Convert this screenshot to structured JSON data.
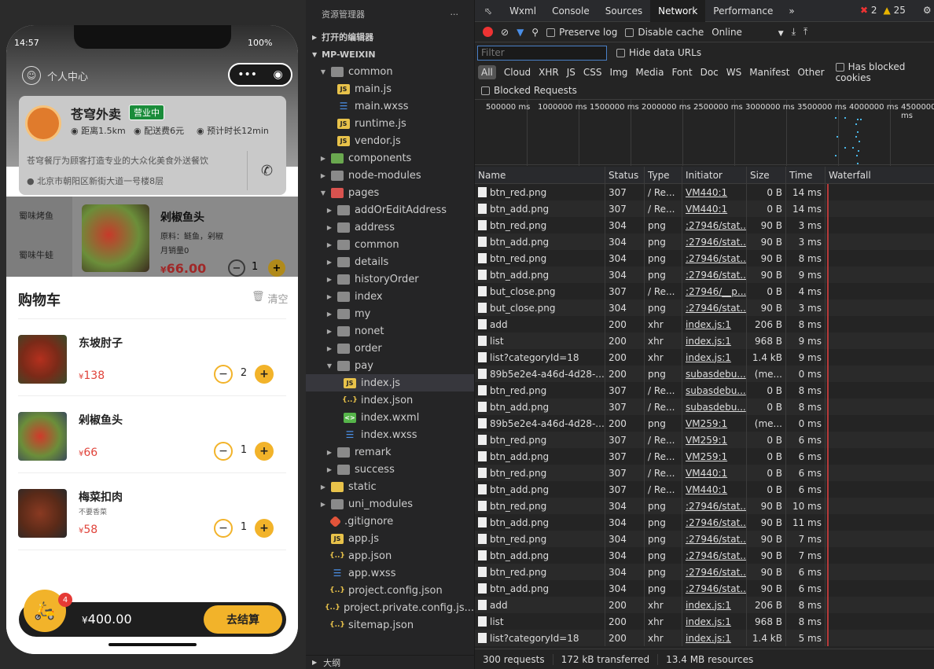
{
  "phone": {
    "time": "14:57",
    "battery": "100%",
    "user_center": "个人中心",
    "shop": {
      "name": "苍穹外卖",
      "badge": "营业中",
      "distance": "距离1.5km",
      "delivery_fee": "配送费6元",
      "eta": "预计时长12min",
      "desc": "苍穹餐厅为顾客打造专业的大众化美食外送餐饮",
      "address": "北京市朝阳区新街大道一号楼8层"
    },
    "categories": [
      "蜀味烤鱼",
      "蜀味牛蛙"
    ],
    "dish": {
      "name": "剁椒鱼头",
      "material": "原料：鲢鱼，剁椒",
      "sales": "月销量0",
      "price": "66.00",
      "qty": "1"
    },
    "cart": {
      "title": "购物车",
      "clear": "清空",
      "items": [
        {
          "name": "东坡肘子",
          "note": "",
          "price": "138",
          "qty": "2"
        },
        {
          "name": "剁椒鱼头",
          "note": "",
          "price": "66",
          "qty": "1"
        },
        {
          "name": "梅菜扣肉",
          "note": "不要香菜",
          "price": "58",
          "qty": "1"
        }
      ],
      "badge": "4",
      "total": "400.00",
      "checkout": "去结算"
    }
  },
  "explorer": {
    "title": "资源管理器",
    "open_editors": "打开的编辑器",
    "project": "MP-WEIXIN",
    "tree": [
      {
        "name": "common",
        "type": "folder",
        "indent": 1,
        "open": true
      },
      {
        "name": "main.js",
        "type": "js",
        "indent": 2
      },
      {
        "name": "main.wxss",
        "type": "wxss",
        "indent": 2
      },
      {
        "name": "runtime.js",
        "type": "js",
        "indent": 2
      },
      {
        "name": "vendor.js",
        "type": "js",
        "indent": 2
      },
      {
        "name": "components",
        "type": "comp",
        "indent": 1
      },
      {
        "name": "node-modules",
        "type": "folder",
        "indent": 1
      },
      {
        "name": "pages",
        "type": "pages",
        "indent": 1,
        "open": true
      },
      {
        "name": "addOrEditAddress",
        "type": "folder",
        "indent": 2
      },
      {
        "name": "address",
        "type": "folder",
        "indent": 2
      },
      {
        "name": "common",
        "type": "folder",
        "indent": 2
      },
      {
        "name": "details",
        "type": "folder",
        "indent": 2
      },
      {
        "name": "historyOrder",
        "type": "folder",
        "indent": 2
      },
      {
        "name": "index",
        "type": "folder",
        "indent": 2
      },
      {
        "name": "my",
        "type": "folder",
        "indent": 2
      },
      {
        "name": "nonet",
        "type": "folder",
        "indent": 2
      },
      {
        "name": "order",
        "type": "folder",
        "indent": 2
      },
      {
        "name": "pay",
        "type": "folder",
        "indent": 2,
        "open": true
      },
      {
        "name": "index.js",
        "type": "js",
        "indent": 3,
        "selected": true
      },
      {
        "name": "index.json",
        "type": "json",
        "indent": 3
      },
      {
        "name": "index.wxml",
        "type": "wxml",
        "indent": 3
      },
      {
        "name": "index.wxss",
        "type": "wxss",
        "indent": 3
      },
      {
        "name": "remark",
        "type": "folder",
        "indent": 2
      },
      {
        "name": "success",
        "type": "folder",
        "indent": 2
      },
      {
        "name": "static",
        "type": "static",
        "indent": 1
      },
      {
        "name": "uni_modules",
        "type": "folder",
        "indent": 1
      },
      {
        "name": ".gitignore",
        "type": "git",
        "indent": 1
      },
      {
        "name": "app.js",
        "type": "js",
        "indent": 1
      },
      {
        "name": "app.json",
        "type": "json",
        "indent": 1
      },
      {
        "name": "app.wxss",
        "type": "wxss",
        "indent": 1
      },
      {
        "name": "project.config.json",
        "type": "json",
        "indent": 1
      },
      {
        "name": "project.private.config.js...",
        "type": "json",
        "indent": 1
      },
      {
        "name": "sitemap.json",
        "type": "json",
        "indent": 1
      }
    ],
    "outline": "大纲"
  },
  "devtools": {
    "tabs": [
      "Wxml",
      "Console",
      "Sources",
      "Network",
      "Performance"
    ],
    "active_tab": "Network",
    "errors": "2",
    "warnings": "25",
    "preserve_log": "Preserve log",
    "disable_cache": "Disable cache",
    "throttle": "Online",
    "filter_placeholder": "Filter",
    "hide_data_urls": "Hide data URLs",
    "types": [
      "All",
      "Cloud",
      "XHR",
      "JS",
      "CSS",
      "Img",
      "Media",
      "Font",
      "Doc",
      "WS",
      "Manifest",
      "Other"
    ],
    "has_blocked_cookies": "Has blocked cookies",
    "blocked_requests": "Blocked Requests",
    "ticks": [
      "500000 ms",
      "1000000 ms",
      "1500000 ms",
      "2000000 ms",
      "2500000 ms",
      "3000000 ms",
      "3500000 ms",
      "4000000 ms",
      "4500000 ms"
    ],
    "columns": [
      "Name",
      "Status",
      "Type",
      "Initiator",
      "Size",
      "Time",
      "Waterfall"
    ],
    "requests": [
      [
        "btn_red.png",
        "307",
        "/ Re...",
        "VM440:1",
        "0 B",
        "14 ms"
      ],
      [
        "btn_add.png",
        "307",
        "/ Re...",
        "VM440:1",
        "0 B",
        "14 ms"
      ],
      [
        "btn_red.png",
        "304",
        "png",
        ":27946/stat...",
        "90 B",
        "3 ms"
      ],
      [
        "btn_add.png",
        "304",
        "png",
        ":27946/stat...",
        "90 B",
        "3 ms"
      ],
      [
        "btn_red.png",
        "304",
        "png",
        ":27946/stat...",
        "90 B",
        "8 ms"
      ],
      [
        "btn_add.png",
        "304",
        "png",
        ":27946/stat...",
        "90 B",
        "9 ms"
      ],
      [
        "but_close.png",
        "307",
        "/ Re...",
        ":27946/__p...",
        "0 B",
        "4 ms"
      ],
      [
        "but_close.png",
        "304",
        "png",
        ":27946/stat...",
        "90 B",
        "3 ms"
      ],
      [
        "add",
        "200",
        "xhr",
        "index.js:1",
        "206 B",
        "8 ms"
      ],
      [
        "list",
        "200",
        "xhr",
        "index.js:1",
        "968 B",
        "9 ms"
      ],
      [
        "list?categoryId=18",
        "200",
        "xhr",
        "index.js:1",
        "1.4 kB",
        "9 ms"
      ],
      [
        "89b5e2e4-a46d-4d28-...",
        "200",
        "png",
        "subasdebu...",
        "(me...",
        "0 ms"
      ],
      [
        "btn_red.png",
        "307",
        "/ Re...",
        "subasdebu...",
        "0 B",
        "8 ms"
      ],
      [
        "btn_add.png",
        "307",
        "/ Re...",
        "subasdebu...",
        "0 B",
        "8 ms"
      ],
      [
        "89b5e2e4-a46d-4d28-...",
        "200",
        "png",
        "VM259:1",
        "(me...",
        "0 ms"
      ],
      [
        "btn_red.png",
        "307",
        "/ Re...",
        "VM259:1",
        "0 B",
        "6 ms"
      ],
      [
        "btn_add.png",
        "307",
        "/ Re...",
        "VM259:1",
        "0 B",
        "6 ms"
      ],
      [
        "btn_red.png",
        "307",
        "/ Re...",
        "VM440:1",
        "0 B",
        "6 ms"
      ],
      [
        "btn_add.png",
        "307",
        "/ Re...",
        "VM440:1",
        "0 B",
        "6 ms"
      ],
      [
        "btn_red.png",
        "304",
        "png",
        ":27946/stat...",
        "90 B",
        "10 ms"
      ],
      [
        "btn_add.png",
        "304",
        "png",
        ":27946/stat...",
        "90 B",
        "11 ms"
      ],
      [
        "btn_red.png",
        "304",
        "png",
        ":27946/stat...",
        "90 B",
        "7 ms"
      ],
      [
        "btn_add.png",
        "304",
        "png",
        ":27946/stat...",
        "90 B",
        "7 ms"
      ],
      [
        "btn_red.png",
        "304",
        "png",
        ":27946/stat...",
        "90 B",
        "6 ms"
      ],
      [
        "btn_add.png",
        "304",
        "png",
        ":27946/stat...",
        "90 B",
        "6 ms"
      ],
      [
        "add",
        "200",
        "xhr",
        "index.js:1",
        "206 B",
        "8 ms"
      ],
      [
        "list",
        "200",
        "xhr",
        "index.js:1",
        "968 B",
        "8 ms"
      ],
      [
        "list?categoryId=18",
        "200",
        "xhr",
        "index.js:1",
        "1.4 kB",
        "5 ms"
      ]
    ],
    "summary": [
      "300 requests",
      "172 kB transferred",
      "13.4 MB resources"
    ]
  }
}
